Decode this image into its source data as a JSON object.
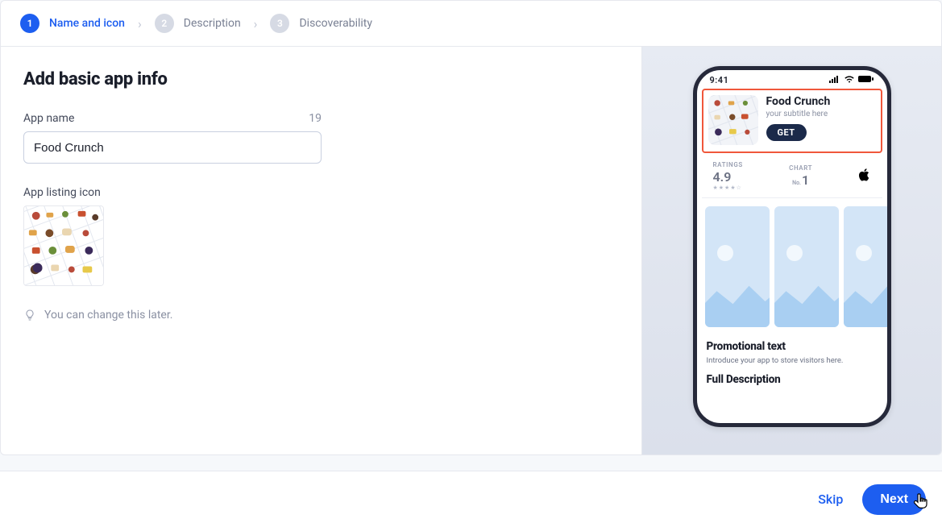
{
  "stepper": {
    "steps": [
      {
        "num": "1",
        "label": "Name and icon"
      },
      {
        "num": "2",
        "label": "Description"
      },
      {
        "num": "3",
        "label": "Discoverability"
      }
    ],
    "active_index": 0
  },
  "form": {
    "heading": "Add basic app info",
    "app_name_label": "App name",
    "app_name_value": "Food Crunch",
    "app_name_count": "19",
    "icon_label": "App listing icon",
    "hint_text": "You can change this later."
  },
  "preview": {
    "statusbar_time": "9:41",
    "app_title": "Food Crunch",
    "app_subtitle": "your subtitle here",
    "get_label": "GET",
    "ratings_label": "RATINGS",
    "ratings_value": "4.9",
    "ratings_stars": "★★★★☆",
    "chart_label": "CHART",
    "chart_no": "No.",
    "chart_value": "1",
    "promo_title": "Promotional text",
    "promo_sub": "Introduce your app to store visitors here.",
    "full_desc": "Full Description"
  },
  "footer": {
    "skip": "Skip",
    "next": "Next"
  }
}
